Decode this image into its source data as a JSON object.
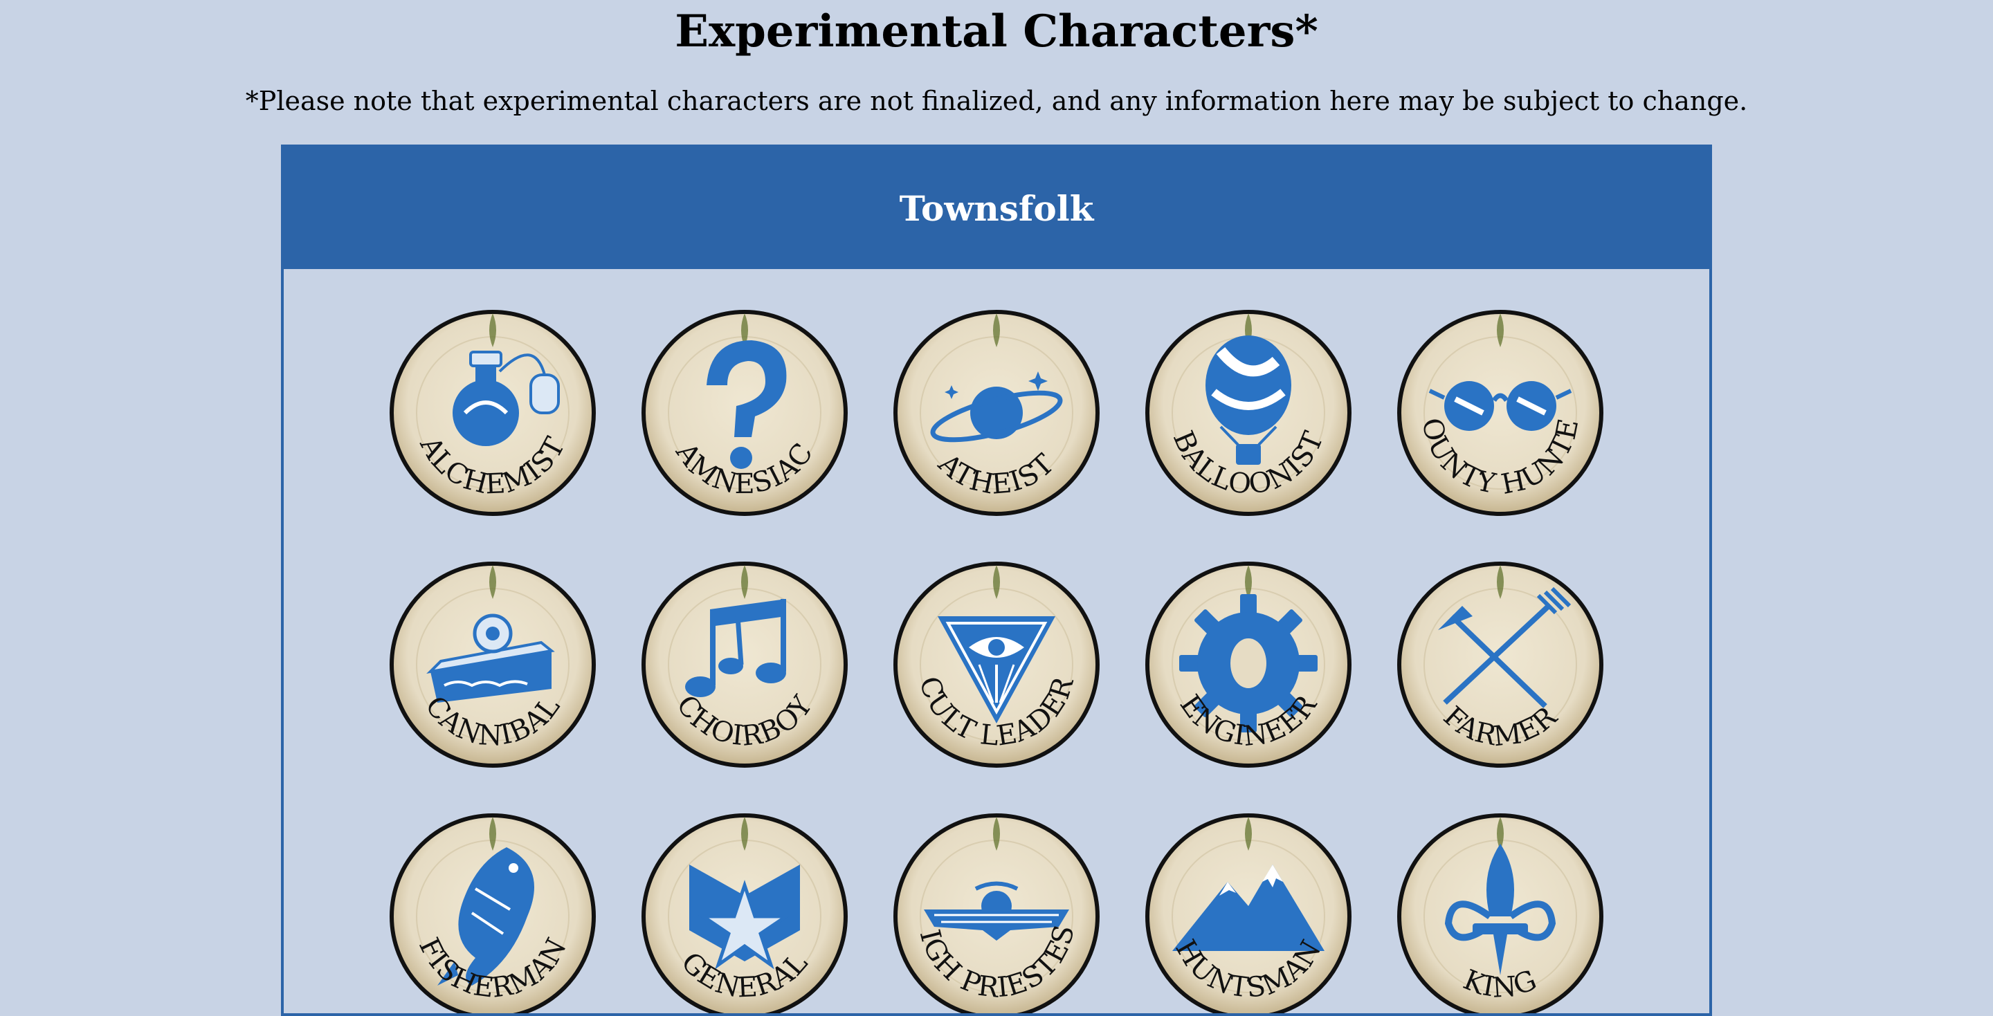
{
  "page": {
    "title": "Experimental Characters*",
    "note": "*Please note that experimental characters are not finalized, and any information here may be subject to change."
  },
  "section": {
    "title": "Townsfolk"
  },
  "characters": [
    {
      "label": "ALCHEMIST",
      "icon": "potion-icon"
    },
    {
      "label": "AMNESIAC",
      "icon": "question-head-icon"
    },
    {
      "label": "ATHEIST",
      "icon": "planet-icon"
    },
    {
      "label": "BALLOONIST",
      "icon": "balloon-icon"
    },
    {
      "label": "BOUNTY HUNTER",
      "icon": "glasses-icon"
    },
    {
      "label": "CANNIBAL",
      "icon": "pie-icon"
    },
    {
      "label": "CHOIRBOY",
      "icon": "music-notes-icon"
    },
    {
      "label": "CULT LEADER",
      "icon": "eye-triangle-icon"
    },
    {
      "label": "ENGINEER",
      "icon": "gear-icon"
    },
    {
      "label": "FARMER",
      "icon": "pitchfork-icon"
    },
    {
      "label": "FISHERMAN",
      "icon": "fish-icon"
    },
    {
      "label": "GENERAL",
      "icon": "star-wings-icon"
    },
    {
      "label": "HIGH PRIESTESS",
      "icon": "winged-sun-icon"
    },
    {
      "label": "HUNTSMAN",
      "icon": "mountains-icon"
    },
    {
      "label": "KING",
      "icon": "fleur-de-lis-icon"
    }
  ],
  "colors": {
    "accent": "#2c64a8",
    "background": "#c8d3e5",
    "token_parchment": "#e6dcc4",
    "icon_blue": "#2a73c4"
  }
}
